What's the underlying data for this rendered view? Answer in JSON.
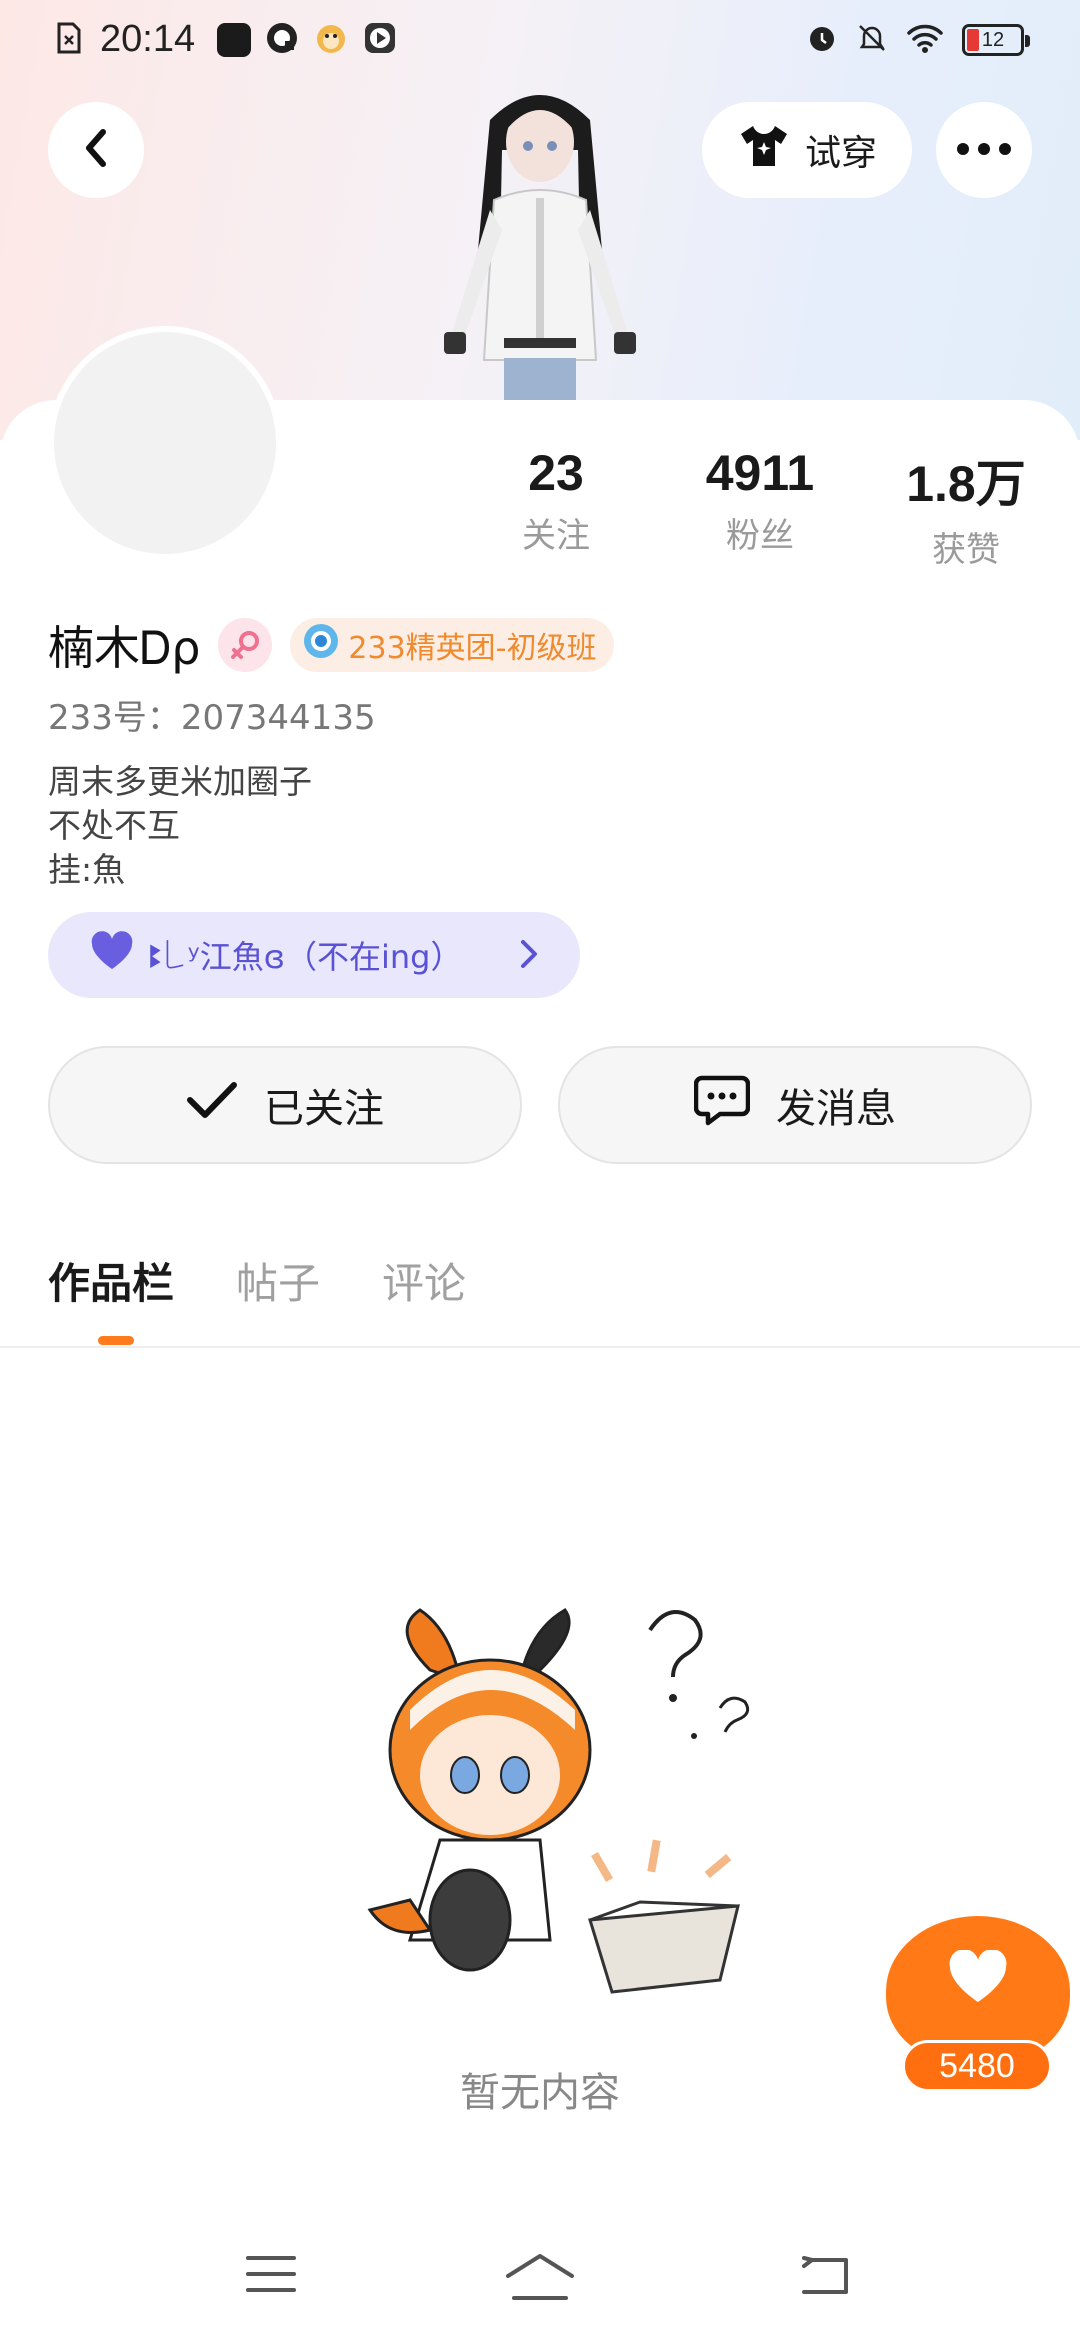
{
  "status_bar": {
    "time": "20:14",
    "battery": "12"
  },
  "header": {
    "tryon_label": "试穿"
  },
  "profile": {
    "stats": [
      {
        "value": "23",
        "label": "关注"
      },
      {
        "value": "4911",
        "label": "粉丝"
      },
      {
        "value": "1.8万",
        "label": "获赞"
      }
    ],
    "name": "楠木Ꭰρ",
    "badge": "233精英团-初级班",
    "uid": "233号：207344135",
    "bio": [
      "周末多更米加圈子",
      "不处不互",
      "挂:魚"
    ],
    "group": "ꔪ꒒ʸ江魚ɞ（不在ing）"
  },
  "actions": {
    "follow_label": "已关注",
    "message_label": "发消息"
  },
  "tabs": [
    "作品栏",
    "帖子",
    "评论"
  ],
  "empty": {
    "text": "暂无内容"
  },
  "like_float": {
    "count": "5480"
  },
  "colors": {
    "accent": "#ff7a1a",
    "badge_text": "#f08a2e",
    "group_text": "#5a52d4"
  }
}
